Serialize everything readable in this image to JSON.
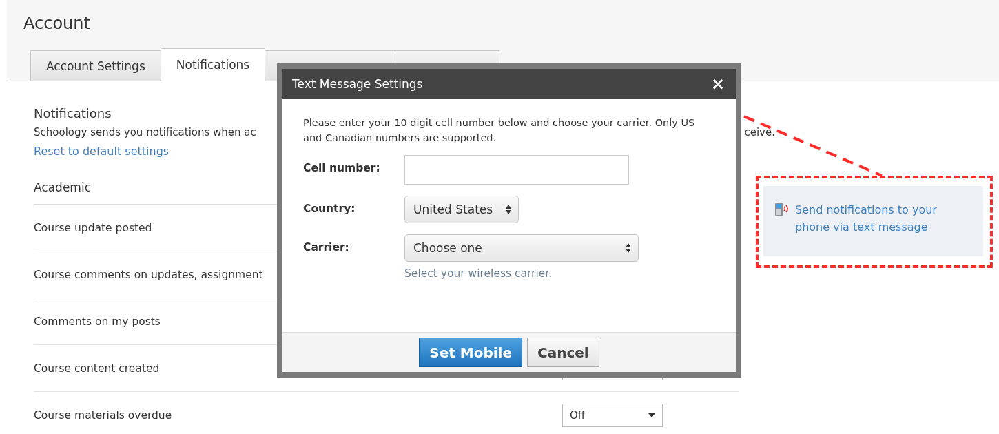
{
  "page": {
    "title": "Account"
  },
  "tabs": [
    {
      "label": "Account Settings",
      "selected": false
    },
    {
      "label": "Notifications",
      "selected": true
    },
    {
      "selected": false
    },
    {
      "selected": false
    }
  ],
  "section": {
    "title": "Notifications",
    "description": "Schoology sends you notifications when ac",
    "description_end": "ceive.",
    "reset_link": "Reset to default settings",
    "group": "Academic"
  },
  "rows": [
    {
      "kind": "plain",
      "label": "Course update posted"
    },
    {
      "kind": "plain",
      "label": "Course comments on updates, assignment"
    },
    {
      "kind": "plain",
      "label": "Comments on my posts"
    },
    {
      "kind": "dropdown",
      "label": "Course content created"
    },
    {
      "kind": "dropdown",
      "label": "Course materials overdue",
      "setting": "Off"
    }
  ],
  "sms_panel": {
    "link": "Send notifications to your phone via text message"
  },
  "dialog": {
    "title": "Text Message Settings",
    "close": "×",
    "intro": "Please enter your 10 digit cell number below and choose your carrier. Only US and Canadian numbers are supported.",
    "fields": [
      {
        "kind": "input",
        "label": "Cell number:"
      },
      {
        "kind": "select",
        "label": "Country:",
        "value": "United States"
      },
      {
        "kind": "select",
        "label": "Carrier:",
        "value": "Choose one",
        "hint": "Select your wireless carrier."
      }
    ],
    "buttons": [
      {
        "label": "Set Mobile",
        "primary": true
      },
      {
        "label": "Cancel",
        "primary": false
      }
    ]
  }
}
